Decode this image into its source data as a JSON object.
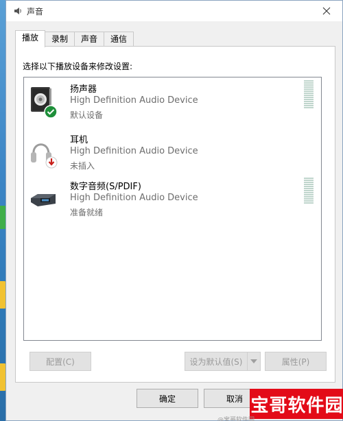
{
  "window": {
    "title": "声音"
  },
  "tabs": [
    {
      "label": "播放",
      "active": true
    },
    {
      "label": "录制",
      "active": false
    },
    {
      "label": "声音",
      "active": false
    },
    {
      "label": "通信",
      "active": false
    }
  ],
  "instruction": "选择以下播放设备来修改设置:",
  "devices": [
    {
      "name": "扬声器",
      "description": "High Definition Audio Device",
      "status": "默认设备",
      "icon": "speaker-icon",
      "badge": "default-check-icon",
      "badge_color": "#1e8f3a",
      "has_meter": true
    },
    {
      "name": "耳机",
      "description": "High Definition Audio Device",
      "status": "未插入",
      "icon": "headphones-icon",
      "badge": "unplugged-arrow-icon",
      "badge_color": "#c8201b",
      "has_meter": false
    },
    {
      "name": "数字音频(S/PDIF)",
      "description": "High Definition Audio Device",
      "status": "准备就绪",
      "icon": "digital-audio-icon",
      "badge": null,
      "has_meter": true
    }
  ],
  "buttons": {
    "configure": "配置(C)",
    "set_default": "设为默认值(S)",
    "properties": "属性(P)",
    "ok": "确定",
    "cancel": "取消"
  },
  "watermark": {
    "text": "宝哥软件园",
    "small": "@宝哥软件园"
  },
  "colors": {
    "accent_red": "#e30b18",
    "meter": "#bfd5cc"
  }
}
